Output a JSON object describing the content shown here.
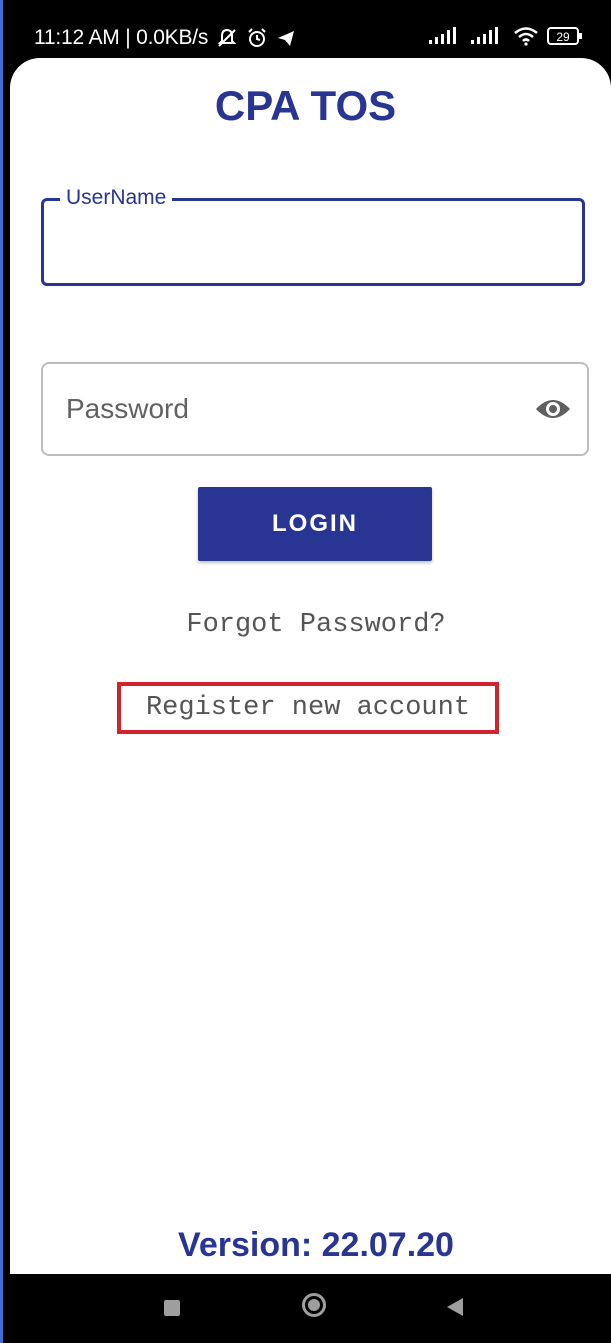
{
  "status_bar": {
    "time_speed": "11:12 AM | 0.0KB/s",
    "battery": "29",
    "icons": [
      "muted-bell-icon",
      "alarm-icon",
      "telegram-icon",
      "signal-icon",
      "signal-icon",
      "wifi-icon",
      "battery-icon"
    ]
  },
  "app": {
    "title": "CPA TOS",
    "username": {
      "label": "UserName",
      "value": ""
    },
    "password": {
      "placeholder": "Password",
      "value": "",
      "toggle_icon": "eye-icon"
    },
    "login_label": "LOGIN",
    "forgot_label": "Forgot Password?",
    "register_label": "Register new account",
    "version": "Version: 22.07.20"
  },
  "nav_bar": {
    "icons": [
      "recent-apps-icon",
      "home-icon",
      "back-icon"
    ]
  },
  "colors": {
    "primary": "#283593",
    "highlight": "#d3222a",
    "link_text": "#555555"
  }
}
